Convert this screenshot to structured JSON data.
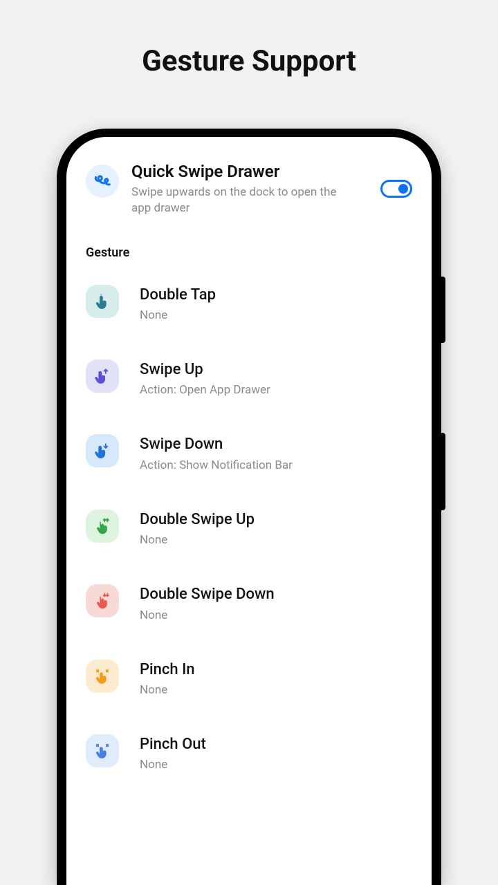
{
  "page_title": "Gesture Support",
  "quick_swipe": {
    "title": "Quick Swipe Drawer",
    "subtitle": "Swipe upwards on the dock to open the app drawer",
    "toggle_on": true
  },
  "section_label": "Gesture",
  "gestures": [
    {
      "id": "double-tap",
      "label": "Double Tap",
      "subtitle": "None"
    },
    {
      "id": "swipe-up",
      "label": "Swipe Up",
      "subtitle": "Action: Open App Drawer"
    },
    {
      "id": "swipe-down",
      "label": "Swipe Down",
      "subtitle": "Action: Show Notification Bar"
    },
    {
      "id": "double-swipe-up",
      "label": "Double Swipe Up",
      "subtitle": "None"
    },
    {
      "id": "double-swipe-down",
      "label": "Double Swipe Down",
      "subtitle": "None"
    },
    {
      "id": "pinch-in",
      "label": "Pinch In",
      "subtitle": "None"
    },
    {
      "id": "pinch-out",
      "label": "Pinch Out",
      "subtitle": "None"
    }
  ]
}
